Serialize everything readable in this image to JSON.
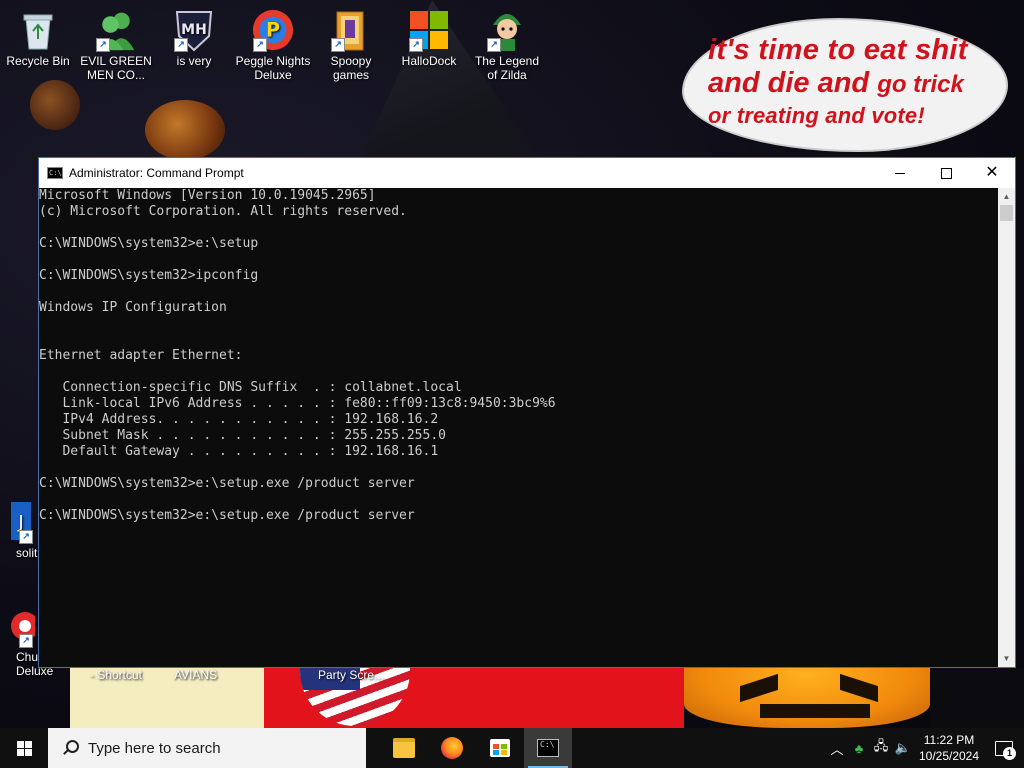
{
  "desktop": {
    "icons": [
      {
        "label": "Recycle Bin"
      },
      {
        "label": "EVIL GREEN MEN CO..."
      },
      {
        "label": "is very"
      },
      {
        "label": "Peggle Nights Deluxe"
      },
      {
        "label": "Spoopy games"
      },
      {
        "label": "HalloDock"
      },
      {
        "label": "The Legend of Zilda"
      }
    ],
    "partial_icons": [
      {
        "label": "solit"
      },
      {
        "label": "Chu Deluxe"
      }
    ],
    "partial_labels": [
      "- Shortcut",
      "AVIANS",
      "Party Scre..."
    ],
    "speech_bubble": {
      "line1": "it's time to eat shit",
      "line2a": "and die and ",
      "line2b": "go trick",
      "line3": "or treating and vote!"
    }
  },
  "window": {
    "title": "Administrator: Command Prompt",
    "console_lines": [
      "Microsoft Windows [Version 10.0.19045.2965]",
      "(c) Microsoft Corporation. All rights reserved.",
      "",
      "C:\\WINDOWS\\system32>e:\\setup",
      "",
      "C:\\WINDOWS\\system32>ipconfig",
      "",
      "Windows IP Configuration",
      "",
      "",
      "Ethernet adapter Ethernet:",
      "",
      "   Connection-specific DNS Suffix  . : collabnet.local",
      "   Link-local IPv6 Address . . . . . : fe80::ff09:13c8:9450:3bc9%6",
      "   IPv4 Address. . . . . . . . . . . : 192.168.16.2",
      "   Subnet Mask . . . . . . . . . . . : 255.255.255.0",
      "   Default Gateway . . . . . . . . . : 192.168.16.1",
      "",
      "C:\\WINDOWS\\system32>e:\\setup.exe /product server",
      "",
      "C:\\WINDOWS\\system32>e:\\setup.exe /product server"
    ]
  },
  "taskbar": {
    "search_placeholder": "Type here to search",
    "apps": [
      "file-explorer",
      "firefox",
      "microsoft-store",
      "command-prompt"
    ],
    "clock_time": "11:22 PM",
    "clock_date": "10/25/2024",
    "notification_count": "1"
  },
  "colors": {
    "console_bg": "#0c0c0c",
    "console_fg": "#cccccc",
    "speech_text": "#d1111b",
    "taskbar_bg": "#101010",
    "active_indicator": "#76b9ed"
  }
}
